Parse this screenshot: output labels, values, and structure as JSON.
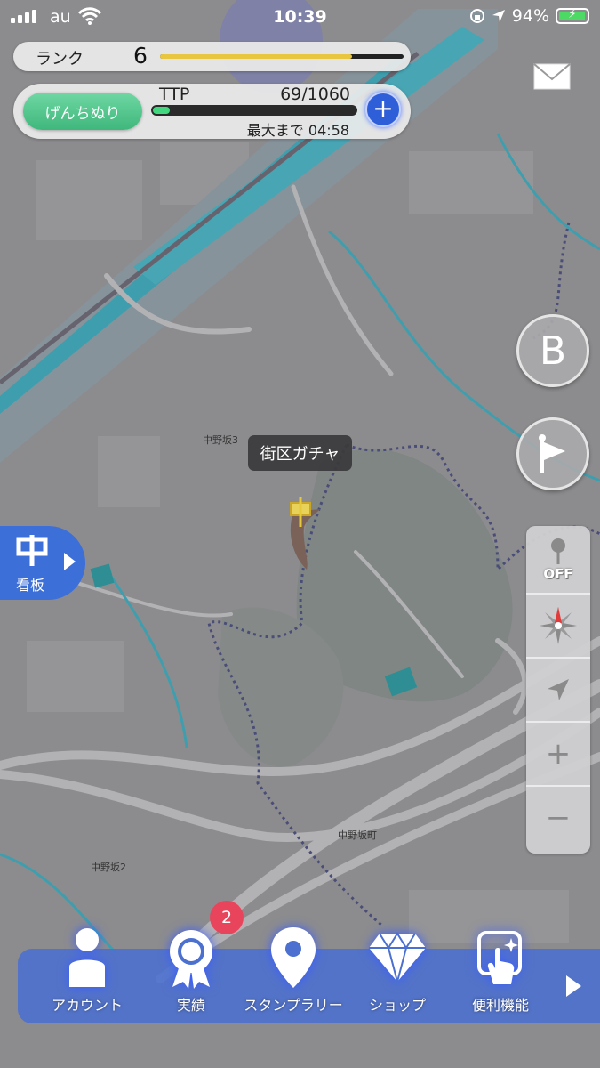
{
  "status_bar": {
    "carrier": "au",
    "time": "10:39",
    "battery": "94%"
  },
  "rank": {
    "label": "ランク",
    "value": "6",
    "progress": 0.79
  },
  "energy": {
    "mode_button": "げんちぬり",
    "ttp_label": "TTP",
    "ttp_value": "69/1060",
    "ttp_progress": 0.065,
    "max_until": "最大まで 04:58",
    "add_button": "+"
  },
  "side_buttons": {
    "b_label": "B",
    "off_label": "OFF",
    "zoom_in": "+",
    "zoom_out": "−"
  },
  "signboard": {
    "label": "看板"
  },
  "map": {
    "tooltip": "街区ガチャ",
    "labels": {
      "a": "中野坂3",
      "b": "中野坂町",
      "c": "中野坂2"
    }
  },
  "bottom_nav": {
    "badge_count": "2",
    "items": [
      {
        "label": "アカウント",
        "icon": "person-icon"
      },
      {
        "label": "実績",
        "icon": "medal-icon"
      },
      {
        "label": "スタンプラリー",
        "icon": "map-pin-icon"
      },
      {
        "label": "ショップ",
        "icon": "diamond-icon"
      },
      {
        "label": "便利機能",
        "icon": "tap-sparkle-icon"
      }
    ]
  },
  "colors": {
    "map_bg": "#8d8d8f",
    "river": "#3f9eae",
    "accent_blue": "#3d6fd9",
    "rank_bar": "#e8c640",
    "ttp_bar": "#42d77f",
    "badge": "#e8455c"
  }
}
